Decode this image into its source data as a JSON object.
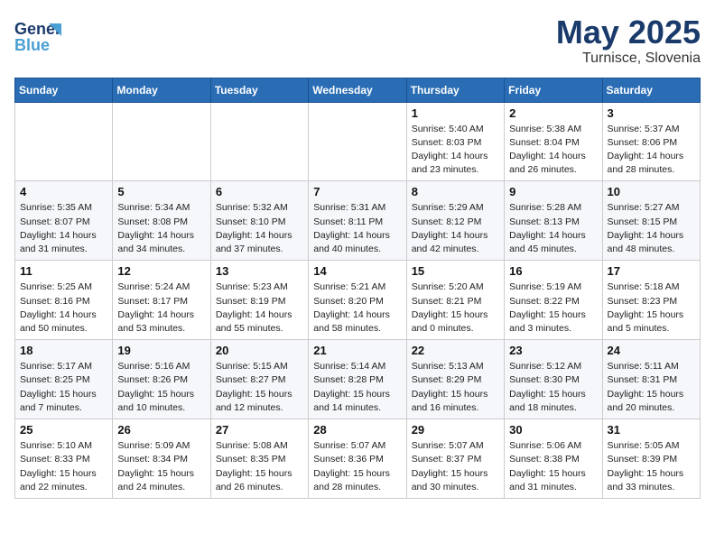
{
  "header": {
    "logo_line1": "General",
    "logo_line2": "Blue",
    "title": "May 2025",
    "location": "Turnisce, Slovenia"
  },
  "weekdays": [
    "Sunday",
    "Monday",
    "Tuesday",
    "Wednesday",
    "Thursday",
    "Friday",
    "Saturday"
  ],
  "weeks": [
    [
      {
        "day": "",
        "detail": ""
      },
      {
        "day": "",
        "detail": ""
      },
      {
        "day": "",
        "detail": ""
      },
      {
        "day": "",
        "detail": ""
      },
      {
        "day": "1",
        "detail": "Sunrise: 5:40 AM\nSunset: 8:03 PM\nDaylight: 14 hours\nand 23 minutes."
      },
      {
        "day": "2",
        "detail": "Sunrise: 5:38 AM\nSunset: 8:04 PM\nDaylight: 14 hours\nand 26 minutes."
      },
      {
        "day": "3",
        "detail": "Sunrise: 5:37 AM\nSunset: 8:06 PM\nDaylight: 14 hours\nand 28 minutes."
      }
    ],
    [
      {
        "day": "4",
        "detail": "Sunrise: 5:35 AM\nSunset: 8:07 PM\nDaylight: 14 hours\nand 31 minutes."
      },
      {
        "day": "5",
        "detail": "Sunrise: 5:34 AM\nSunset: 8:08 PM\nDaylight: 14 hours\nand 34 minutes."
      },
      {
        "day": "6",
        "detail": "Sunrise: 5:32 AM\nSunset: 8:10 PM\nDaylight: 14 hours\nand 37 minutes."
      },
      {
        "day": "7",
        "detail": "Sunrise: 5:31 AM\nSunset: 8:11 PM\nDaylight: 14 hours\nand 40 minutes."
      },
      {
        "day": "8",
        "detail": "Sunrise: 5:29 AM\nSunset: 8:12 PM\nDaylight: 14 hours\nand 42 minutes."
      },
      {
        "day": "9",
        "detail": "Sunrise: 5:28 AM\nSunset: 8:13 PM\nDaylight: 14 hours\nand 45 minutes."
      },
      {
        "day": "10",
        "detail": "Sunrise: 5:27 AM\nSunset: 8:15 PM\nDaylight: 14 hours\nand 48 minutes."
      }
    ],
    [
      {
        "day": "11",
        "detail": "Sunrise: 5:25 AM\nSunset: 8:16 PM\nDaylight: 14 hours\nand 50 minutes."
      },
      {
        "day": "12",
        "detail": "Sunrise: 5:24 AM\nSunset: 8:17 PM\nDaylight: 14 hours\nand 53 minutes."
      },
      {
        "day": "13",
        "detail": "Sunrise: 5:23 AM\nSunset: 8:19 PM\nDaylight: 14 hours\nand 55 minutes."
      },
      {
        "day": "14",
        "detail": "Sunrise: 5:21 AM\nSunset: 8:20 PM\nDaylight: 14 hours\nand 58 minutes."
      },
      {
        "day": "15",
        "detail": "Sunrise: 5:20 AM\nSunset: 8:21 PM\nDaylight: 15 hours\nand 0 minutes."
      },
      {
        "day": "16",
        "detail": "Sunrise: 5:19 AM\nSunset: 8:22 PM\nDaylight: 15 hours\nand 3 minutes."
      },
      {
        "day": "17",
        "detail": "Sunrise: 5:18 AM\nSunset: 8:23 PM\nDaylight: 15 hours\nand 5 minutes."
      }
    ],
    [
      {
        "day": "18",
        "detail": "Sunrise: 5:17 AM\nSunset: 8:25 PM\nDaylight: 15 hours\nand 7 minutes."
      },
      {
        "day": "19",
        "detail": "Sunrise: 5:16 AM\nSunset: 8:26 PM\nDaylight: 15 hours\nand 10 minutes."
      },
      {
        "day": "20",
        "detail": "Sunrise: 5:15 AM\nSunset: 8:27 PM\nDaylight: 15 hours\nand 12 minutes."
      },
      {
        "day": "21",
        "detail": "Sunrise: 5:14 AM\nSunset: 8:28 PM\nDaylight: 15 hours\nand 14 minutes."
      },
      {
        "day": "22",
        "detail": "Sunrise: 5:13 AM\nSunset: 8:29 PM\nDaylight: 15 hours\nand 16 minutes."
      },
      {
        "day": "23",
        "detail": "Sunrise: 5:12 AM\nSunset: 8:30 PM\nDaylight: 15 hours\nand 18 minutes."
      },
      {
        "day": "24",
        "detail": "Sunrise: 5:11 AM\nSunset: 8:31 PM\nDaylight: 15 hours\nand 20 minutes."
      }
    ],
    [
      {
        "day": "25",
        "detail": "Sunrise: 5:10 AM\nSunset: 8:33 PM\nDaylight: 15 hours\nand 22 minutes."
      },
      {
        "day": "26",
        "detail": "Sunrise: 5:09 AM\nSunset: 8:34 PM\nDaylight: 15 hours\nand 24 minutes."
      },
      {
        "day": "27",
        "detail": "Sunrise: 5:08 AM\nSunset: 8:35 PM\nDaylight: 15 hours\nand 26 minutes."
      },
      {
        "day": "28",
        "detail": "Sunrise: 5:07 AM\nSunset: 8:36 PM\nDaylight: 15 hours\nand 28 minutes."
      },
      {
        "day": "29",
        "detail": "Sunrise: 5:07 AM\nSunset: 8:37 PM\nDaylight: 15 hours\nand 30 minutes."
      },
      {
        "day": "30",
        "detail": "Sunrise: 5:06 AM\nSunset: 8:38 PM\nDaylight: 15 hours\nand 31 minutes."
      },
      {
        "day": "31",
        "detail": "Sunrise: 5:05 AM\nSunset: 8:39 PM\nDaylight: 15 hours\nand 33 minutes."
      }
    ]
  ]
}
